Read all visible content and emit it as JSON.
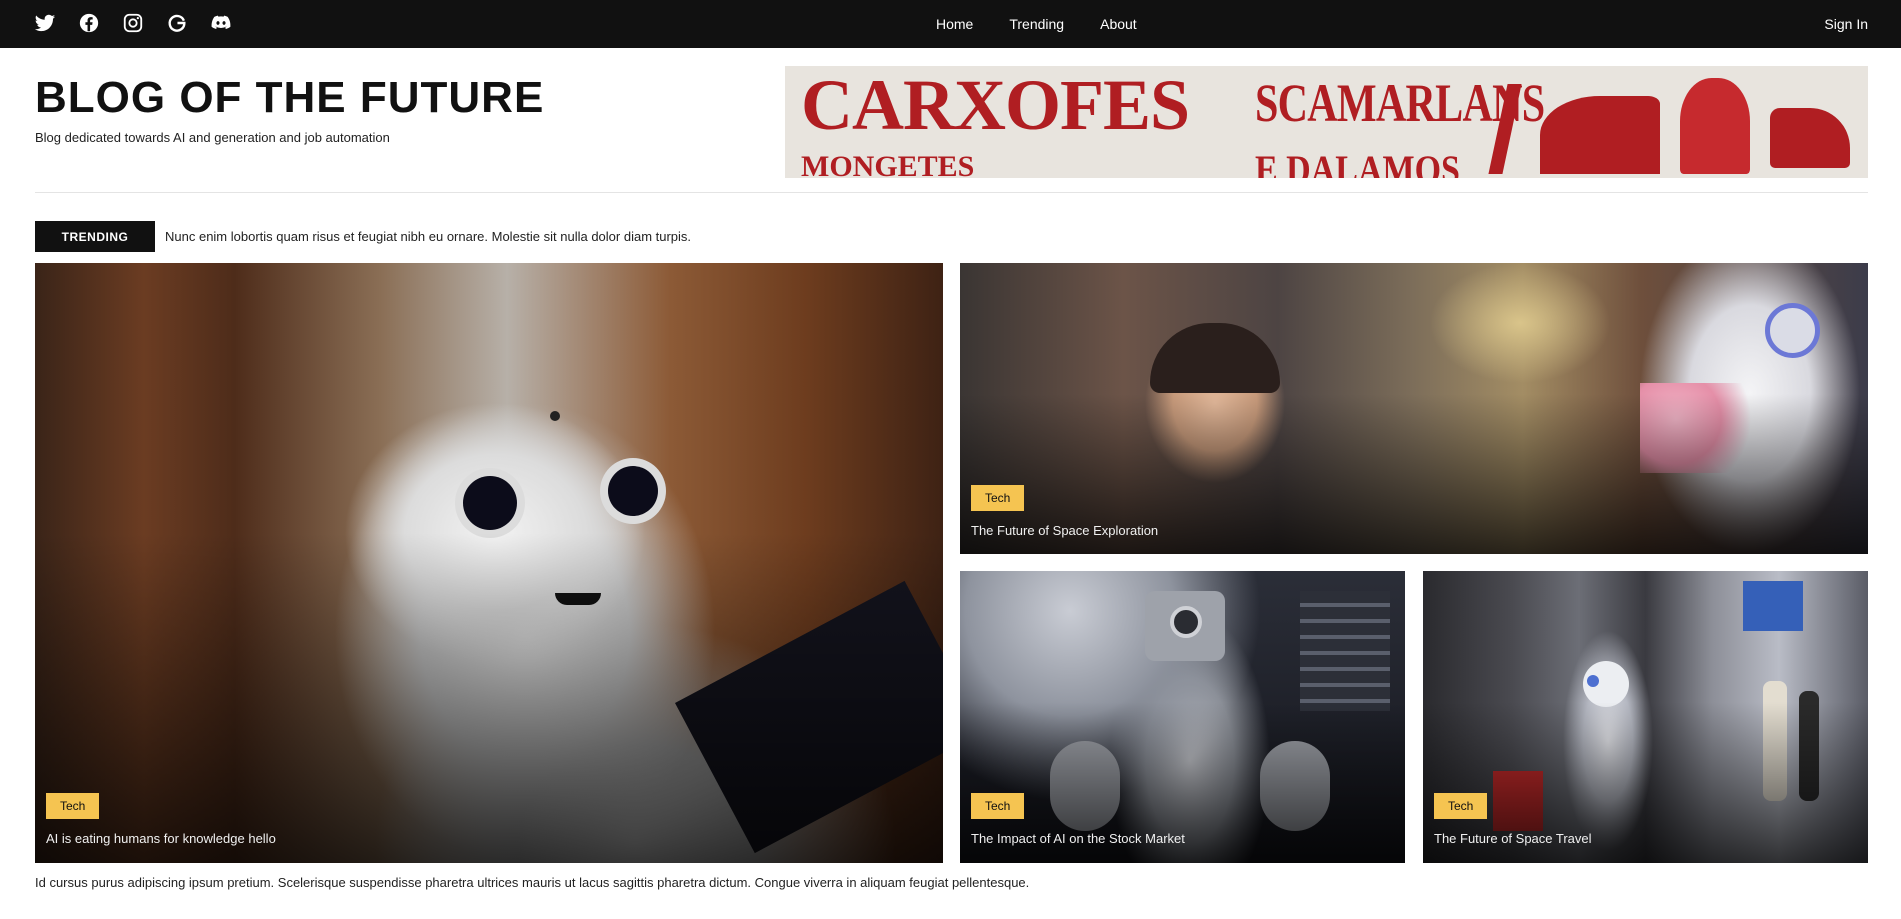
{
  "topbar": {
    "social": [
      {
        "icon": "twitter-icon"
      },
      {
        "icon": "facebook-icon"
      },
      {
        "icon": "instagram-icon"
      },
      {
        "icon": "google-icon"
      },
      {
        "icon": "discord-icon"
      }
    ],
    "nav": [
      "Home",
      "Trending",
      "About"
    ],
    "signin": "Sign In"
  },
  "header": {
    "title": "BLOG OF THE FUTURE",
    "tagline": "Blog dedicated towards AI and generation and job automation",
    "banner_words": [
      "CARXOFES",
      "SCAMARLANS",
      "MONGETES",
      "E DALAMOS"
    ]
  },
  "trending": {
    "label": "TRENDING",
    "text": "Nunc enim lobortis quam risus et feugiat nibh eu ornare. Molestie sit nulla dolor diam turpis."
  },
  "cards": [
    {
      "tag": "Tech",
      "title": "AI is eating humans for knowledge hello"
    },
    {
      "tag": "Tech",
      "title": "The Future of Space Exploration"
    },
    {
      "tag": "Tech",
      "title": "The Impact of AI on the Stock Market"
    },
    {
      "tag": "Tech",
      "title": "The Future of Space Travel"
    }
  ],
  "footer_text": "Id cursus purus adipiscing ipsum pretium. Scelerisque suspendisse pharetra ultrices mauris ut lacus sagittis pharetra dictum. Congue viverra in aliquam feugiat pellentesque.",
  "colors": {
    "topbar": "#111111",
    "tag": "#f5c451",
    "banner_red": "#b01e22"
  }
}
